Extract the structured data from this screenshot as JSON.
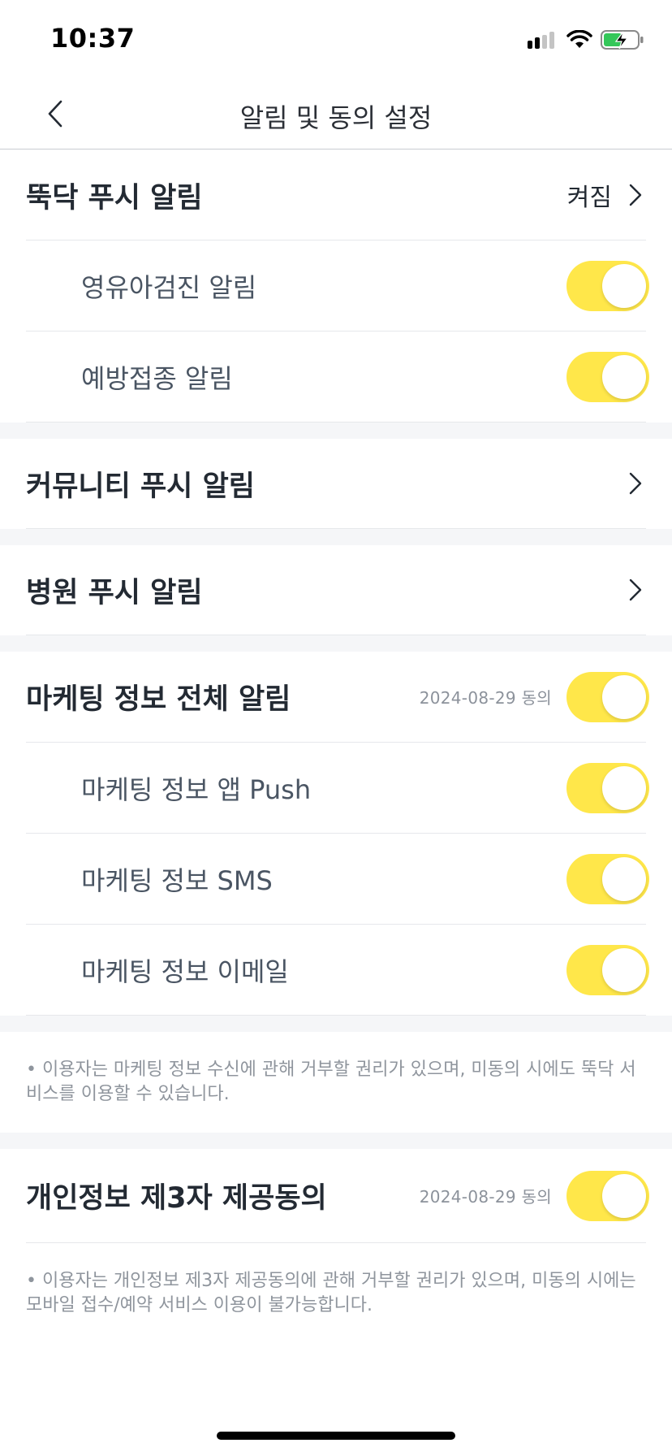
{
  "status_bar": {
    "time": "10:37"
  },
  "nav": {
    "title": "알림 및 동의 설정"
  },
  "sections": {
    "ttokdak": {
      "title": "뚝닥 푸시 알림",
      "status": "켜짐",
      "items": [
        {
          "label": "영유아검진 알림",
          "on": true
        },
        {
          "label": "예방접종 알림",
          "on": true
        }
      ]
    },
    "community": {
      "title": "커뮤니티 푸시 알림"
    },
    "hospital": {
      "title": "병원 푸시 알림"
    },
    "marketing": {
      "title": "마케팅 정보 전체 알림",
      "date": "2024-08-29 동의",
      "on": true,
      "items": [
        {
          "label": "마케팅 정보 앱 Push",
          "on": true
        },
        {
          "label": "마케팅 정보 SMS",
          "on": true
        },
        {
          "label": "마케팅 정보 이메일",
          "on": true
        }
      ],
      "notice": "• 이용자는 마케팅 정보 수신에 관해 거부할 권리가 있으며, 미동의 시에도 뚝닥 서비스를 이용할 수 있습니다."
    },
    "third_party": {
      "title": "개인정보 제3자 제공동의",
      "date": "2024-08-29 동의",
      "on": true,
      "notice": "• 이용자는 개인정보 제3자 제공동의에 관해 거부할 권리가 있으며, 미동의 시에는 모바일 접수/예약 서비스 이용이 불가능합니다."
    }
  },
  "colors": {
    "toggle_on": "#ffe74a",
    "divider": "#e6e8eb",
    "section_gap": "#f5f6f8"
  }
}
